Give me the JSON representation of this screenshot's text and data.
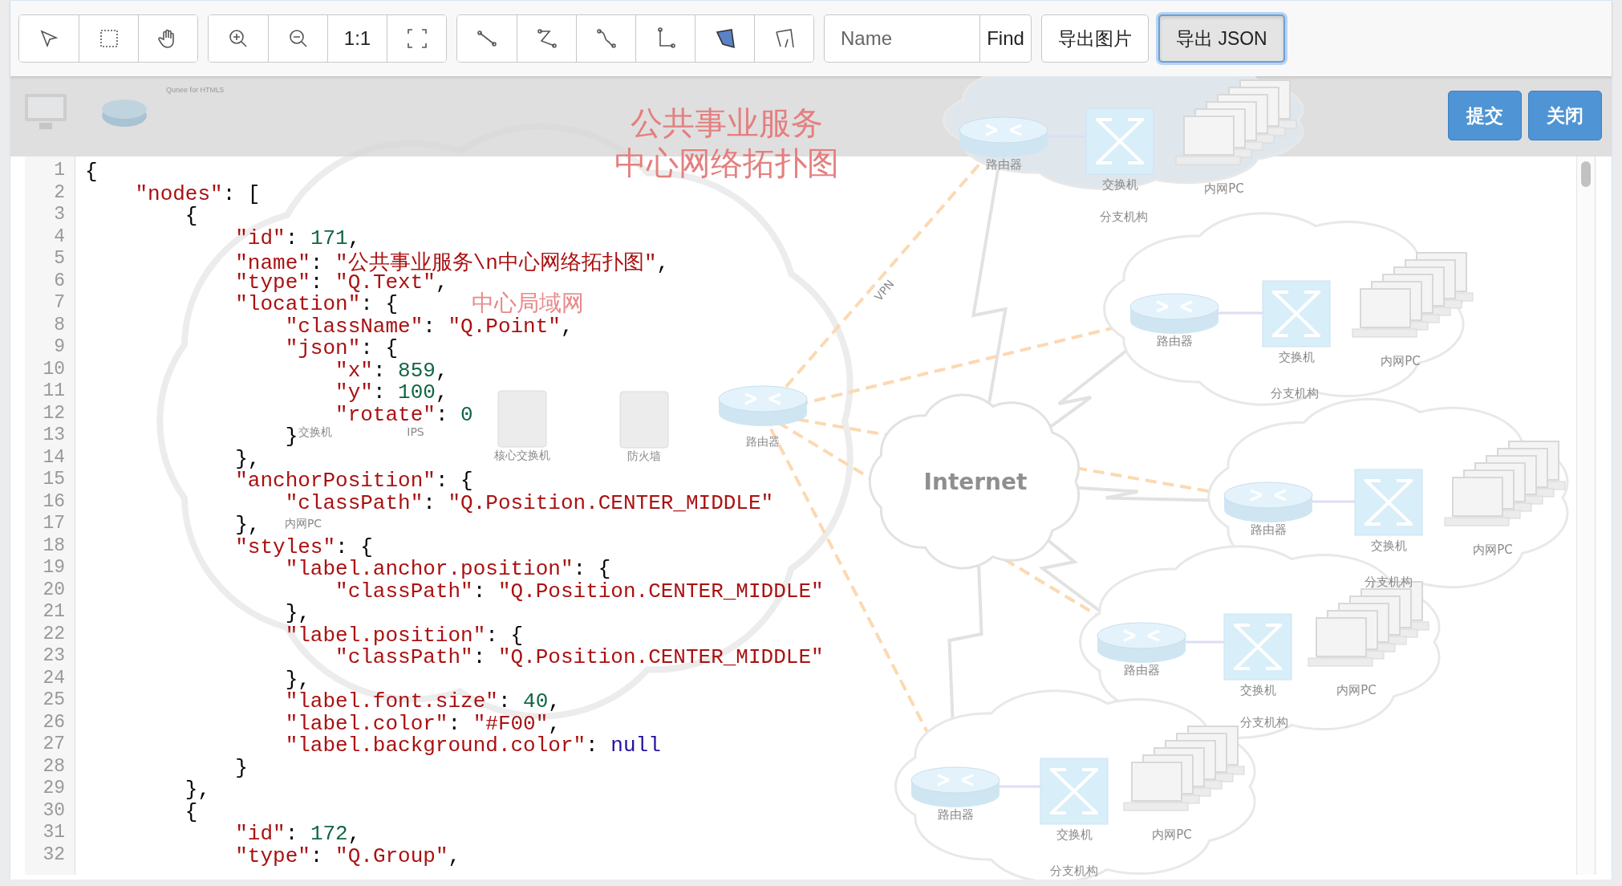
{
  "toolbar": {
    "groups": [
      {
        "buttons": [
          {
            "kind": "icon"
          },
          {
            "kind": "icon"
          },
          {
            "kind": "icon"
          }
        ]
      },
      {
        "buttons": [
          {
            "kind": "icon"
          },
          {
            "kind": "icon"
          },
          {
            "kind": "text",
            "label": "1:1"
          },
          {
            "kind": "icon"
          }
        ]
      },
      {
        "buttons": [
          {
            "kind": "icon"
          },
          {
            "kind": "icon"
          },
          {
            "kind": "icon"
          },
          {
            "kind": "icon"
          },
          {
            "kind": "icon"
          },
          {
            "kind": "icon"
          }
        ]
      }
    ],
    "search": {
      "placeholder": "Name",
      "button": "Find"
    },
    "actions": [
      {
        "label": "导出图片",
        "focused": false
      },
      {
        "label": "导出 JSON",
        "focused": true
      }
    ]
  },
  "header": {
    "brand": "Qunee for HTML5",
    "buttons": [
      "提交",
      "关闭"
    ]
  },
  "diagram": {
    "title": [
      "公共事业服务",
      "中心网络拓扑图"
    ],
    "internet": "Internet",
    "vpn": "VPN",
    "center": {
      "title": "中心局域网",
      "nodes": [
        "交换机",
        "IPS",
        "核心交换机",
        "防火墙",
        "路由器",
        "内网PC"
      ]
    },
    "branches": [
      {
        "router": "路由器",
        "switch": "交换机",
        "pc": "内网PC",
        "name": "分支机构"
      },
      {
        "router": "路由器",
        "switch": "交换机",
        "pc": "内网PC",
        "name": "分支机构"
      },
      {
        "router": "路由器",
        "switch": "交换机",
        "pc": "内网PC",
        "name": "分支机构"
      },
      {
        "router": "路由器",
        "switch": "交换机",
        "pc": "内网PC",
        "name": "分支机构"
      },
      {
        "router": "路由器",
        "switch": "交换机",
        "pc": "内网PC",
        "name": "分支机构"
      }
    ]
  },
  "editor": {
    "lines": [
      {
        "n": "1",
        "text": "{"
      },
      {
        "n": "2",
        "text": "    \"nodes\": ["
      },
      {
        "n": "3",
        "text": "        {"
      },
      {
        "n": "4",
        "text": "            \"id\": 171,"
      },
      {
        "n": "5",
        "text": "            \"name\": \"公共事业服务\\n中心网络拓扑图\","
      },
      {
        "n": "6",
        "text": "            \"type\": \"Q.Text\","
      },
      {
        "n": "7",
        "text": "            \"location\": {"
      },
      {
        "n": "8",
        "text": "                \"className\": \"Q.Point\","
      },
      {
        "n": "9",
        "text": "                \"json\": {"
      },
      {
        "n": "10",
        "text": "                    \"x\": 859,"
      },
      {
        "n": "11",
        "text": "                    \"y\": 100,"
      },
      {
        "n": "12",
        "text": "                    \"rotate\": 0"
      },
      {
        "n": "13",
        "text": "                }"
      },
      {
        "n": "14",
        "text": "            },"
      },
      {
        "n": "15",
        "text": "            \"anchorPosition\": {"
      },
      {
        "n": "16",
        "text": "                \"classPath\": \"Q.Position.CENTER_MIDDLE\""
      },
      {
        "n": "17",
        "text": "            },"
      },
      {
        "n": "18",
        "text": "            \"styles\": {"
      },
      {
        "n": "19",
        "text": "                \"label.anchor.position\": {"
      },
      {
        "n": "20",
        "text": "                    \"classPath\": \"Q.Position.CENTER_MIDDLE\""
      },
      {
        "n": "21",
        "text": "                },"
      },
      {
        "n": "22",
        "text": "                \"label.position\": {"
      },
      {
        "n": "23",
        "text": "                    \"classPath\": \"Q.Position.CENTER_MIDDLE\""
      },
      {
        "n": "24",
        "text": "                },"
      },
      {
        "n": "25",
        "text": "                \"label.font.size\": 40,"
      },
      {
        "n": "26",
        "text": "                \"label.color\": \"#F00\","
      },
      {
        "n": "27",
        "text": "                \"label.background.color\": null"
      },
      {
        "n": "28",
        "text": "            }"
      },
      {
        "n": "29",
        "text": "        },"
      },
      {
        "n": "30",
        "text": "        {"
      },
      {
        "n": "31",
        "text": "            \"id\": 172,"
      },
      {
        "n": "32",
        "text": "            \"type\": \"Q.Group\","
      }
    ]
  }
}
